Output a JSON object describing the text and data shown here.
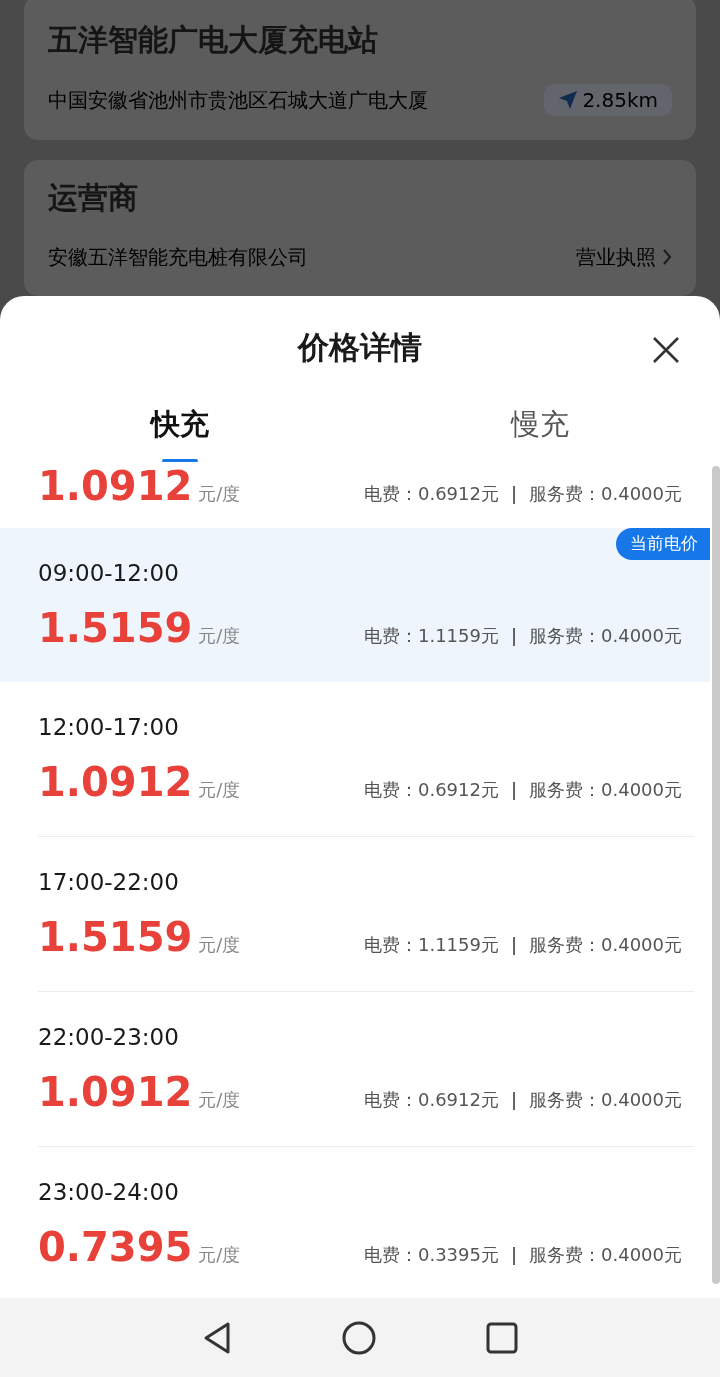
{
  "background": {
    "station": {
      "name": "五洋智能广电大厦充电站",
      "address": "中国安徽省池州市贵池区石城大道广电大厦",
      "distance": "2.85km"
    },
    "operator": {
      "title": "运营商",
      "company": "安徽五洋智能充电桩有限公司",
      "license_link": "营业执照"
    }
  },
  "sheet": {
    "title": "价格详情",
    "tabs": [
      {
        "label": "快充",
        "selected": true
      },
      {
        "label": "慢充",
        "selected": false
      }
    ],
    "rows": [
      {
        "kind": "partial",
        "price": "1.0912",
        "unit": "元/度",
        "electricity_fee": "电费：0.6912元",
        "separator": "|",
        "service_fee": "服务费：0.4000元",
        "current": false
      },
      {
        "kind": "full",
        "time": "09:00-12:00",
        "price": "1.5159",
        "unit": "元/度",
        "electricity_fee": "电费：1.1159元",
        "separator": "|",
        "service_fee": "服务费：0.4000元",
        "current": true,
        "badge": "当前电价"
      },
      {
        "kind": "full",
        "time": "12:00-17:00",
        "price": "1.0912",
        "unit": "元/度",
        "electricity_fee": "电费：0.6912元",
        "separator": "|",
        "service_fee": "服务费：0.4000元",
        "current": false
      },
      {
        "kind": "full",
        "time": "17:00-22:00",
        "price": "1.5159",
        "unit": "元/度",
        "electricity_fee": "电费：1.1159元",
        "separator": "|",
        "service_fee": "服务费：0.4000元",
        "current": false
      },
      {
        "kind": "full",
        "time": "22:00-23:00",
        "price": "1.0912",
        "unit": "元/度",
        "electricity_fee": "电费：0.6912元",
        "separator": "|",
        "service_fee": "服务费：0.4000元",
        "current": false
      },
      {
        "kind": "full",
        "time": "23:00-24:00",
        "price": "0.7395",
        "unit": "元/度",
        "electricity_fee": "电费：0.3395元",
        "separator": "|",
        "service_fee": "服务费：0.4000元",
        "current": false
      }
    ]
  }
}
